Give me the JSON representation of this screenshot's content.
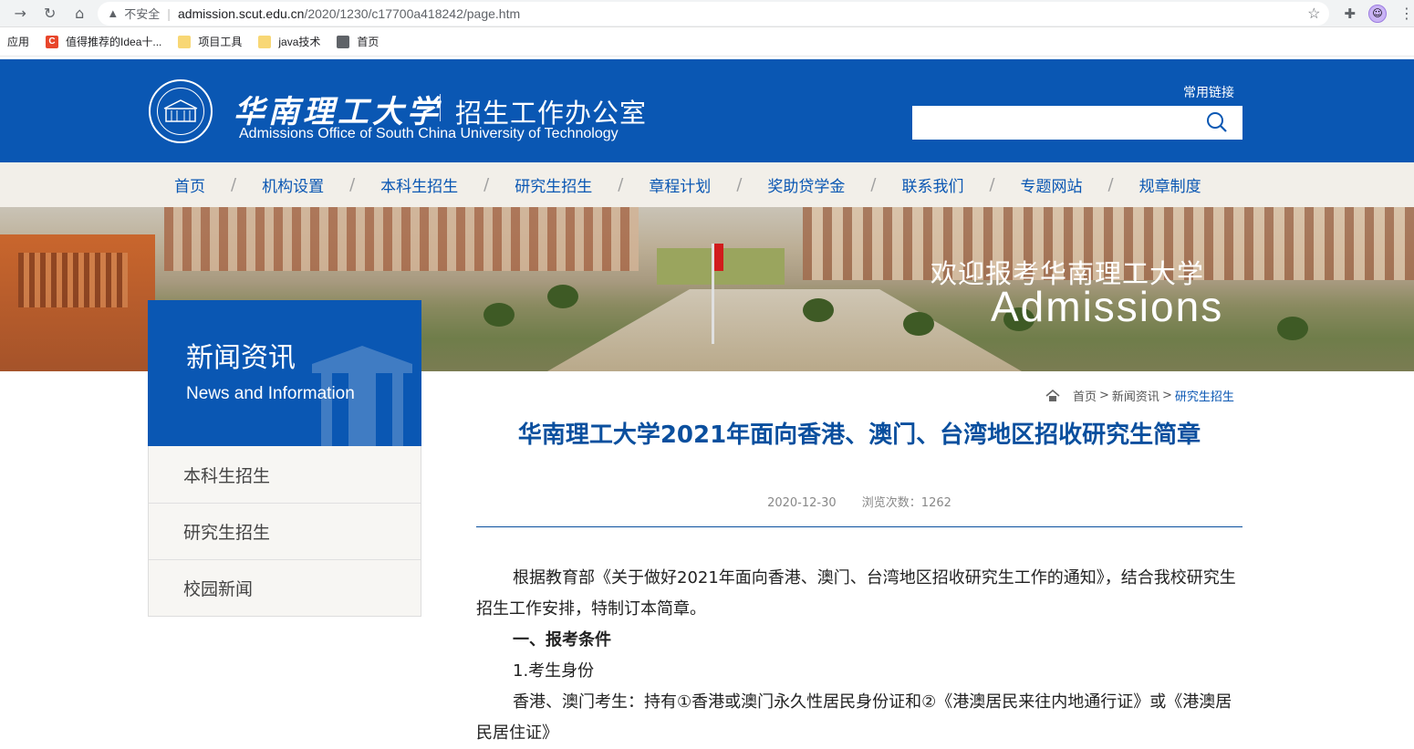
{
  "browser": {
    "insecure_label": "不安全",
    "url_host": "admission.scut.edu.cn",
    "url_path": "/2020/1230/c17700a418242/page.htm",
    "bookmarks": [
      "应用",
      "值得推荐的Idea十...",
      "项目工具",
      "java技术",
      "首页"
    ]
  },
  "header": {
    "logo_cn": "华南理工大学",
    "office": "招生工作办公室",
    "logo_en": "Admissions Office of South China University of Technology",
    "quick_link": "常用链接",
    "search_placeholder": ""
  },
  "nav": [
    "首页",
    "机构设置",
    "本科生招生",
    "研究生招生",
    "章程计划",
    "奖助贷学金",
    "联系我们",
    "专题网站",
    "规章制度"
  ],
  "banner": {
    "welcome_cn": "欢迎报考华南理工大学",
    "welcome_en": "Admissions"
  },
  "sidebar": {
    "title_cn": "新闻资讯",
    "title_en": "News and Information",
    "items": [
      "本科生招生",
      "研究生招生",
      "校园新闻"
    ]
  },
  "breadcrumb": {
    "home": "首页",
    "sep": ">",
    "section": "新闻资讯",
    "current": "研究生招生"
  },
  "article": {
    "title": "华南理工大学2021年面向香港、澳门、台湾地区招收研究生简章",
    "date": "2020-12-30",
    "views": "浏览次数：1262",
    "para1": "根据教育部《关于做好2021年面向香港、澳门、台湾地区招收研究生工作的通知》，结合我校研究生招生工作安排，特制订本简章。",
    "heading1": "一、报考条件",
    "sub1": "1.考生身份",
    "para2": "香港、澳门考生：持有①香港或澳门永久性居民身份证和②《港澳居民来往内地通行证》或《港澳居民居住证》"
  },
  "colors": {
    "brand_blue": "#0a57b3",
    "nav_bg": "#f2efe9",
    "title_blue": "#0a4f9e"
  }
}
